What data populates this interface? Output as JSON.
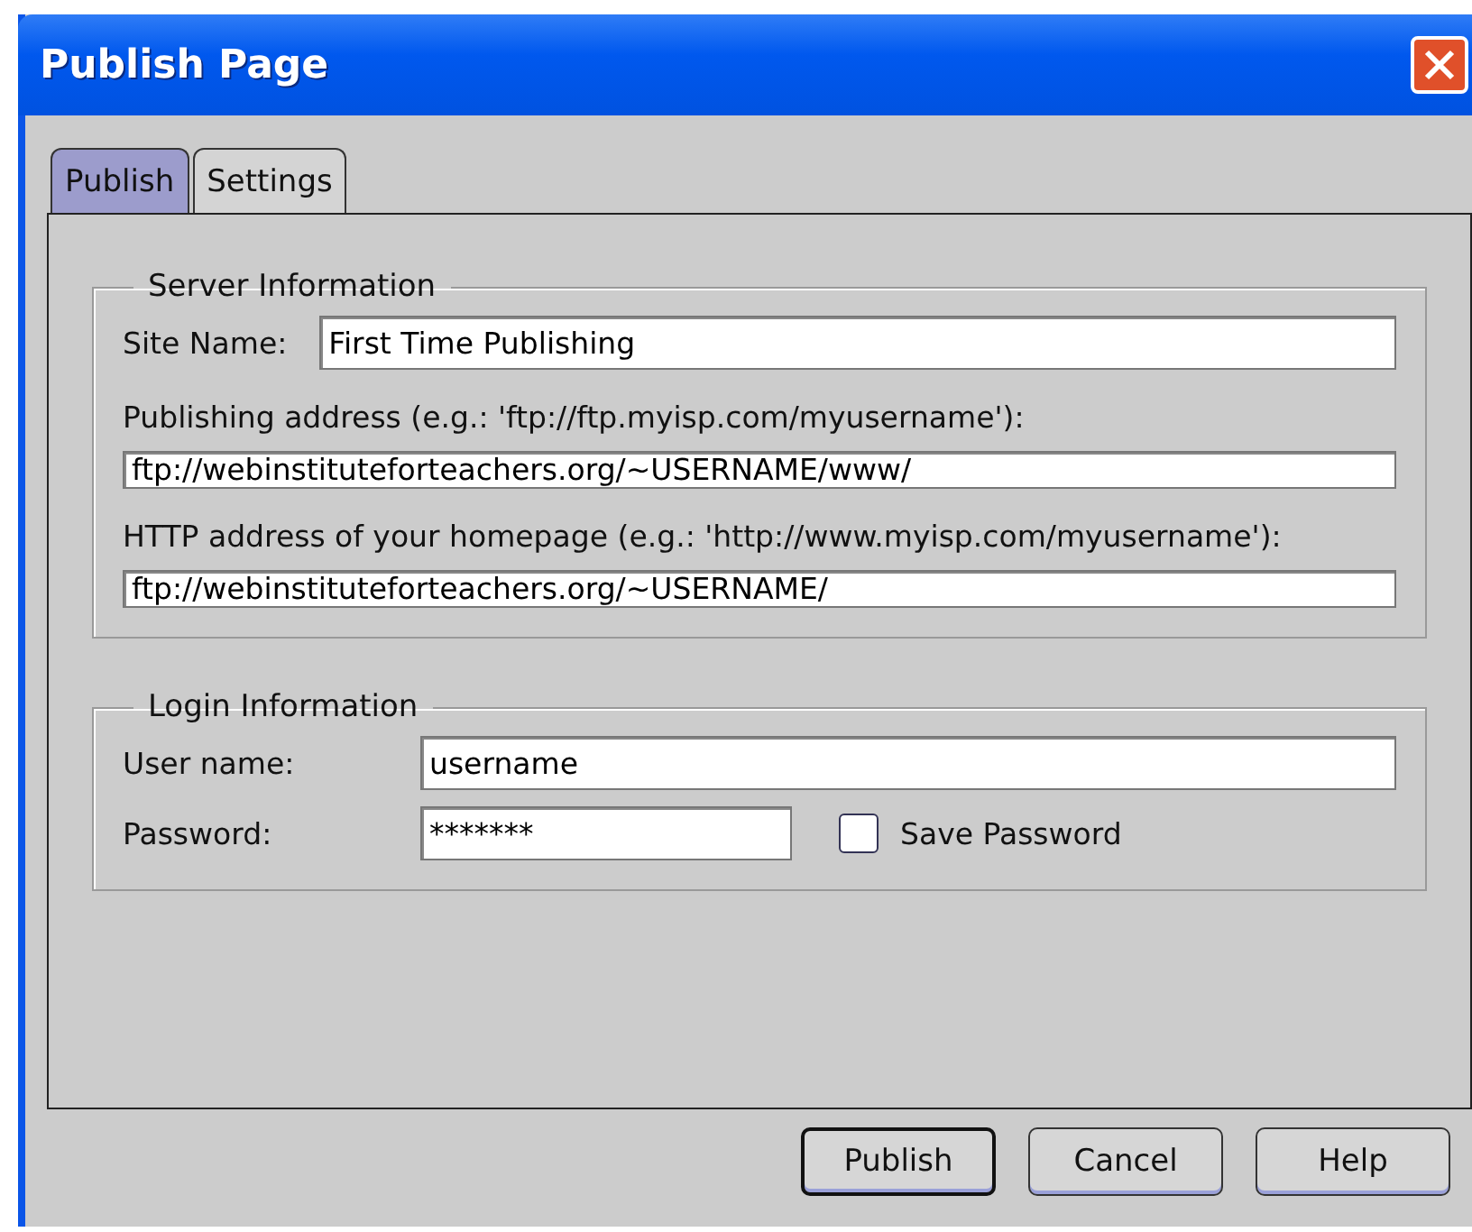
{
  "window": {
    "title": "Publish Page"
  },
  "tabs": [
    {
      "label": "Publish",
      "selected": true
    },
    {
      "label": "Settings",
      "selected": false
    }
  ],
  "server_information": {
    "legend": "Server Information",
    "site_name_label": "Site Name:",
    "site_name_value": "First Time Publishing",
    "publishing_address_label": "Publishing address (e.g.: 'ftp://ftp.myisp.com/myusername'):",
    "publishing_address_value": "ftp://webinstituteforteachers.org/~USERNAME/www/",
    "http_address_label": "HTTP address of your homepage (e.g.: 'http://www.myisp.com/myusername'):",
    "http_address_value": "ftp://webinstituteforteachers.org/~USERNAME/"
  },
  "login_information": {
    "legend": "Login Information",
    "user_name_label": "User name:",
    "user_name_value": "username",
    "password_label": "Password:",
    "password_value": "*******",
    "save_password": {
      "label": "Save Password",
      "checked": false
    }
  },
  "buttons": [
    {
      "label": "Publish",
      "default": true
    },
    {
      "label": "Cancel",
      "default": false
    },
    {
      "label": "Help",
      "default": false
    }
  ]
}
